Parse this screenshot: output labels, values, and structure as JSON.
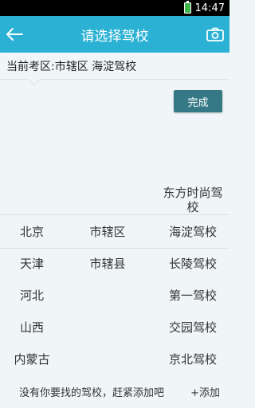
{
  "status_bar": {
    "time": "14:47"
  },
  "header": {
    "title": "请选择驾校"
  },
  "area": {
    "text": "当前考区:市辖区 海淀驾校"
  },
  "done_button": {
    "label": "完成"
  },
  "picker": {
    "provinces": [
      "北京",
      "天津",
      "河北",
      "山西",
      "内蒙古"
    ],
    "districts": [
      "市辖区",
      "市辖县"
    ],
    "schools": [
      "东方时尚驾校",
      "海淀驾校",
      "长陵驾校",
      "第一驾校",
      "交园驾校",
      "京北驾校"
    ]
  },
  "footer": {
    "hint": "没有你要找的驾校，赶紧添加吧",
    "add_label": "+添加"
  },
  "colors": {
    "title_bar": "#2bb1d4",
    "done_button": "#357886",
    "background": "#f0f6f8"
  }
}
